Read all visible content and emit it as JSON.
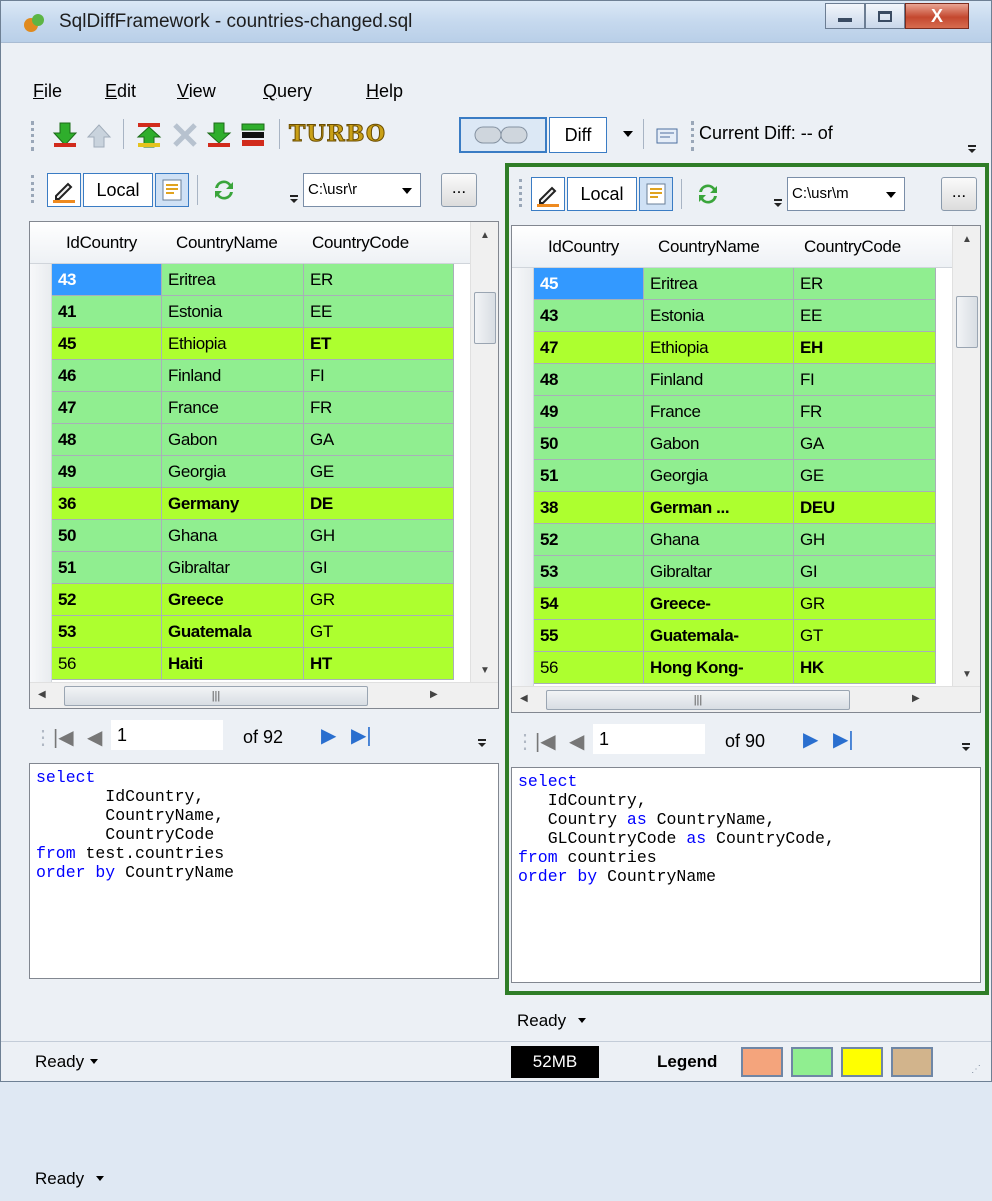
{
  "window": {
    "title": "SqlDiffFramework - countries-changed.sql",
    "close_label": "X"
  },
  "menu": [
    "File",
    "Edit",
    "View",
    "Query",
    "Help"
  ],
  "toolbar": {
    "turbo_label": "TURBO",
    "diff_label": "Diff",
    "current_diff_label": "Current Diff:  --  of"
  },
  "colors": {
    "match_row": "#90ee90",
    "diff_row": "#adff2f",
    "selected": "#3399ff",
    "pane_border": "#2f7d27",
    "legend": [
      "#f4a47c",
      "#90ee90",
      "#ffff00",
      "#d2b48c"
    ]
  },
  "left": {
    "local_label": "Local",
    "path": "C:\\usr\\r",
    "dots_label": "...",
    "columns": [
      "IdCountry",
      "CountryName",
      "CountryCode"
    ],
    "rows": [
      {
        "id": "43",
        "name": "Eritrea",
        "code": "ER",
        "hl": "m",
        "b": [
          false,
          false
        ]
      },
      {
        "id": "41",
        "name": "Estonia",
        "code": "EE",
        "hl": "m",
        "b": [
          false,
          false
        ]
      },
      {
        "id": "45",
        "name": "Ethiopia",
        "code": "ET",
        "hl": "d",
        "b": [
          false,
          true
        ]
      },
      {
        "id": "46",
        "name": "Finland",
        "code": "FI",
        "hl": "m",
        "b": [
          false,
          false
        ]
      },
      {
        "id": "47",
        "name": "France",
        "code": "FR",
        "hl": "m",
        "b": [
          false,
          false
        ]
      },
      {
        "id": "48",
        "name": "Gabon",
        "code": "GA",
        "hl": "m",
        "b": [
          false,
          false
        ]
      },
      {
        "id": "49",
        "name": "Georgia",
        "code": "GE",
        "hl": "m",
        "b": [
          false,
          false
        ]
      },
      {
        "id": "36",
        "name": "Germany",
        "code": "DE",
        "hl": "d",
        "b": [
          true,
          true
        ]
      },
      {
        "id": "50",
        "name": "Ghana",
        "code": "GH",
        "hl": "m",
        "b": [
          false,
          false
        ]
      },
      {
        "id": "51",
        "name": "Gibraltar",
        "code": "GI",
        "hl": "m",
        "b": [
          false,
          false
        ]
      },
      {
        "id": "52",
        "name": "Greece",
        "code": "GR",
        "hl": "d",
        "b": [
          true,
          false
        ]
      },
      {
        "id": "53",
        "name": "Guatemala",
        "code": "GT",
        "hl": "d",
        "b": [
          true,
          false
        ]
      },
      {
        "id": "56",
        "name": "Haiti",
        "code": "HT",
        "hl": "d",
        "b": [
          true,
          true
        ],
        "idplain": true
      }
    ],
    "page": "1",
    "of": "of 92",
    "sql": [
      [
        [
          "kw",
          "select"
        ]
      ],
      [
        [
          "",
          "       IdCountry,"
        ]
      ],
      [
        [
          "",
          "       CountryName,"
        ]
      ],
      [
        [
          "",
          "       CountryCode"
        ]
      ],
      [
        [
          "kw",
          "from"
        ],
        [
          "",
          " test.countries"
        ]
      ],
      [
        [
          "kw",
          "order by"
        ],
        [
          "",
          " CountryName"
        ]
      ]
    ],
    "status": "Ready"
  },
  "right": {
    "local_label": "Local",
    "path": "C:\\usr\\m",
    "dots_label": "...",
    "columns": [
      "IdCountry",
      "CountryName",
      "CountryCode"
    ],
    "rows": [
      {
        "id": "45",
        "name": "Eritrea",
        "code": "ER",
        "hl": "m",
        "b": [
          false,
          false
        ]
      },
      {
        "id": "43",
        "name": "Estonia",
        "code": "EE",
        "hl": "m",
        "b": [
          false,
          false
        ]
      },
      {
        "id": "47",
        "name": "Ethiopia",
        "code": "EH",
        "hl": "d",
        "b": [
          false,
          true
        ]
      },
      {
        "id": "48",
        "name": "Finland",
        "code": "FI",
        "hl": "m",
        "b": [
          false,
          false
        ]
      },
      {
        "id": "49",
        "name": "France",
        "code": "FR",
        "hl": "m",
        "b": [
          false,
          false
        ]
      },
      {
        "id": "50",
        "name": "Gabon",
        "code": "GA",
        "hl": "m",
        "b": [
          false,
          false
        ]
      },
      {
        "id": "51",
        "name": "Georgia",
        "code": "GE",
        "hl": "m",
        "b": [
          false,
          false
        ]
      },
      {
        "id": "38",
        "name": "German ...",
        "code": "DEU",
        "hl": "d",
        "b": [
          true,
          true
        ]
      },
      {
        "id": "52",
        "name": "Ghana",
        "code": "GH",
        "hl": "m",
        "b": [
          false,
          false
        ]
      },
      {
        "id": "53",
        "name": "Gibraltar",
        "code": "GI",
        "hl": "m",
        "b": [
          false,
          false
        ]
      },
      {
        "id": "54",
        "name": "Greece-",
        "code": "GR",
        "hl": "d",
        "b": [
          true,
          false
        ]
      },
      {
        "id": "55",
        "name": "Guatemala-",
        "code": "GT",
        "hl": "d",
        "b": [
          true,
          false
        ]
      },
      {
        "id": "56",
        "name": "Hong Kong-",
        "code": "HK",
        "hl": "d",
        "b": [
          true,
          true
        ],
        "idplain": true
      }
    ],
    "page": "1",
    "of": "of 90",
    "sql": [
      [
        [
          "kw",
          "select"
        ]
      ],
      [
        [
          "",
          "   IdCountry,"
        ]
      ],
      [
        [
          "",
          "   Country "
        ],
        [
          "kw",
          "as"
        ],
        [
          "",
          " CountryName,"
        ]
      ],
      [
        [
          "",
          "   GLCountryCode "
        ],
        [
          "kw",
          "as"
        ],
        [
          "",
          " CountryCode,"
        ]
      ],
      [
        [
          "kw",
          "from"
        ],
        [
          "",
          " countries"
        ]
      ],
      [
        [
          "kw",
          "order by"
        ],
        [
          "",
          " CountryName"
        ]
      ]
    ],
    "status": "Ready"
  },
  "bottom": {
    "status": "Ready",
    "memory": "52MB",
    "legend_label": "Legend"
  }
}
